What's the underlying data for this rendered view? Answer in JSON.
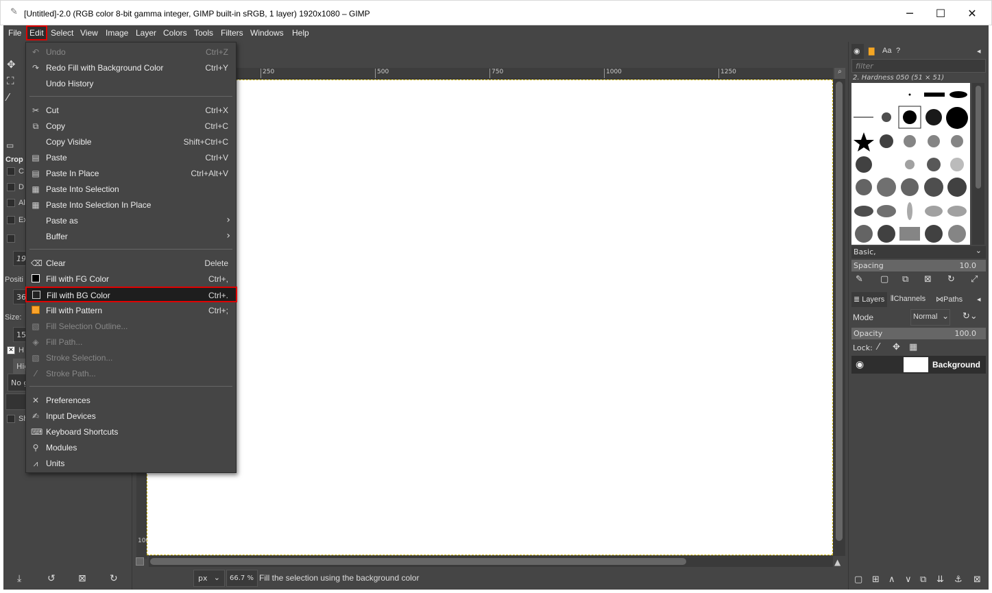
{
  "window": {
    "title": "[Untitled]-2.0 (RGB color 8-bit gamma integer, GIMP built-in sRGB, 1 layer) 1920x1080 – GIMP",
    "minimize": "─",
    "maximize": "☐",
    "close": "✕"
  },
  "menubar": {
    "items": [
      "File",
      "Edit",
      "Select",
      "View",
      "Image",
      "Layer",
      "Colors",
      "Tools",
      "Filters",
      "Windows",
      "Help"
    ]
  },
  "edit_menu": {
    "items": [
      {
        "label": "Undo",
        "shortcut": "Ctrl+Z",
        "icon": "undo-icon",
        "disabled": true
      },
      {
        "label": "Redo Fill with Background Color",
        "shortcut": "Ctrl+Y",
        "icon": "redo-icon"
      },
      {
        "label": "Undo History",
        "shortcut": "",
        "icon": ""
      },
      {
        "label": "Cut",
        "shortcut": "Ctrl+X",
        "icon": "scissors-icon"
      },
      {
        "label": "Copy",
        "shortcut": "Ctrl+C",
        "icon": "copy-icon"
      },
      {
        "label": "Copy Visible",
        "shortcut": "Shift+Ctrl+C",
        "icon": ""
      },
      {
        "label": "Paste",
        "shortcut": "Ctrl+V",
        "icon": "paste-icon"
      },
      {
        "label": "Paste In Place",
        "shortcut": "Ctrl+Alt+V",
        "icon": "paste-in-place-icon"
      },
      {
        "label": "Paste Into Selection",
        "shortcut": "",
        "icon": "paste-into-icon"
      },
      {
        "label": "Paste Into Selection In Place",
        "shortcut": "",
        "icon": "paste-into-in-place-icon"
      },
      {
        "label": "Paste as",
        "shortcut": "",
        "icon": "",
        "submenu": true
      },
      {
        "label": "Buffer",
        "shortcut": "",
        "icon": "",
        "submenu": true
      },
      {
        "label": "Clear",
        "shortcut": "Delete",
        "icon": "clear-icon"
      },
      {
        "label": "Fill with FG Color",
        "shortcut": "Ctrl+,",
        "icon": "fg-swatch-icon"
      },
      {
        "label": "Fill with BG Color",
        "shortcut": "Ctrl+.",
        "icon": "bg-swatch-icon",
        "highlighted": true
      },
      {
        "label": "Fill with Pattern",
        "shortcut": "Ctrl+;",
        "icon": "pattern-swatch-icon"
      },
      {
        "label": "Fill Selection Outline...",
        "shortcut": "",
        "icon": "fill-outline-icon",
        "disabled": true
      },
      {
        "label": "Fill Path...",
        "shortcut": "",
        "icon": "fill-path-icon",
        "disabled": true
      },
      {
        "label": "Stroke Selection...",
        "shortcut": "",
        "icon": "stroke-selection-icon",
        "disabled": true
      },
      {
        "label": "Stroke Path...",
        "shortcut": "",
        "icon": "stroke-path-icon",
        "disabled": true
      },
      {
        "label": "Preferences",
        "shortcut": "",
        "icon": "preferences-icon"
      },
      {
        "label": "Input Devices",
        "shortcut": "",
        "icon": "input-devices-icon"
      },
      {
        "label": "Keyboard Shortcuts",
        "shortcut": "",
        "icon": "keyboard-icon"
      },
      {
        "label": "Modules",
        "shortcut": "",
        "icon": "modules-icon"
      },
      {
        "label": "Units",
        "shortcut": "",
        "icon": "units-icon"
      }
    ]
  },
  "toolbox": {
    "tool_label": "Crop",
    "position_label": "Positi",
    "position_value": "36",
    "size_label": "Size:",
    "size_value": "15",
    "field_value": "19",
    "highlight_label": "Hig",
    "guides_label": "No g",
    "option_letters": [
      "C",
      "D",
      "Al",
      "Ex",
      "H",
      "Sh"
    ]
  },
  "ruler": {
    "ticks": [
      "250",
      "500",
      "750",
      "1000",
      "1250"
    ],
    "vertical": "100"
  },
  "statusbar": {
    "unit": "px",
    "zoom": "66.7 %",
    "message": "Fill the selection using the background color"
  },
  "brushes": {
    "filter_placeholder": "filter",
    "current": "2. Hardness 050 (51 × 51)",
    "set": "Basic,",
    "spacing_label": "Spacing",
    "spacing_value": "10.0"
  },
  "layers": {
    "tabs": [
      "Layers",
      "Channels",
      "Paths"
    ],
    "mode_label": "Mode",
    "mode_value": "Normal",
    "opacity_label": "Opacity",
    "opacity_value": "100.0",
    "lock_label": "Lock:",
    "layer_name": "Background"
  },
  "colors": {
    "highlight_border": "#e00000",
    "theme_bg": "#454545",
    "pattern_orange": "#ffa033"
  }
}
